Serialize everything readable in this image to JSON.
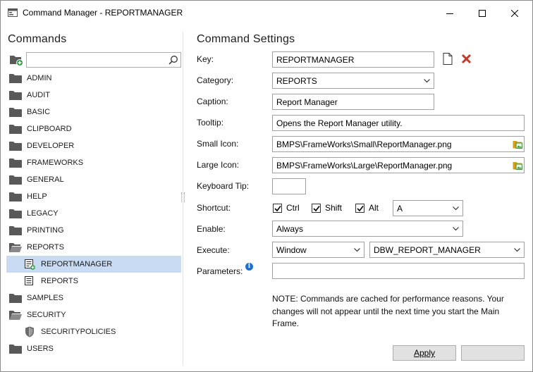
{
  "window": {
    "title": "Command Manager - REPORTMANAGER"
  },
  "left": {
    "title": "Commands",
    "search": {
      "value": "",
      "placeholder": ""
    },
    "tree": [
      {
        "label": "ADMIN",
        "level": 0,
        "icon": "folder-icon"
      },
      {
        "label": "AUDIT",
        "level": 0,
        "icon": "folder-icon"
      },
      {
        "label": "BASIC",
        "level": 0,
        "icon": "folder-icon"
      },
      {
        "label": "CLIPBOARD",
        "level": 0,
        "icon": "folder-icon"
      },
      {
        "label": "DEVELOPER",
        "level": 0,
        "icon": "folder-icon"
      },
      {
        "label": "FRAMEWORKS",
        "level": 0,
        "icon": "folder-icon"
      },
      {
        "label": "GENERAL",
        "level": 0,
        "icon": "folder-icon"
      },
      {
        "label": "HELP",
        "level": 0,
        "icon": "folder-icon"
      },
      {
        "label": "LEGACY",
        "level": 0,
        "icon": "folder-icon"
      },
      {
        "label": "PRINTING",
        "level": 0,
        "icon": "folder-icon"
      },
      {
        "label": "REPORTS",
        "level": 0,
        "icon": "folder-open-icon"
      },
      {
        "label": "REPORTMANAGER",
        "level": 1,
        "icon": "command-add-icon",
        "selected": true
      },
      {
        "label": "REPORTS",
        "level": 1,
        "icon": "command-icon"
      },
      {
        "label": "SAMPLES",
        "level": 0,
        "icon": "folder-icon"
      },
      {
        "label": "SECURITY",
        "level": 0,
        "icon": "folder-open-icon"
      },
      {
        "label": "SECURITYPOLICIES",
        "level": 1,
        "icon": "shield-icon"
      },
      {
        "label": "USERS",
        "level": 0,
        "icon": "folder-icon"
      }
    ]
  },
  "settings": {
    "title": "Command Settings",
    "key": {
      "label": "Key:",
      "value": "REPORTMANAGER"
    },
    "category": {
      "label": "Category:",
      "value": "REPORTS"
    },
    "caption": {
      "label": "Caption:",
      "value": "Report Manager"
    },
    "tooltip": {
      "label": "Tooltip:",
      "value": "Opens the Report Manager utility."
    },
    "small_icon": {
      "label": "Small Icon:",
      "value": "BMPS\\FrameWorks\\Small\\ReportManager.png"
    },
    "large_icon": {
      "label": "Large Icon:",
      "value": "BMPS\\FrameWorks\\Large\\ReportManager.png"
    },
    "keyboard_tip": {
      "label": "Keyboard Tip:",
      "value": ""
    },
    "shortcut": {
      "label": "Shortcut:",
      "ctrl": {
        "label": "Ctrl",
        "checked": true
      },
      "shift": {
        "label": "Shift",
        "checked": true
      },
      "alt": {
        "label": "Alt",
        "checked": true
      },
      "key": "A"
    },
    "enable": {
      "label": "Enable:",
      "value": "Always"
    },
    "execute": {
      "label": "Execute:",
      "type": "Window",
      "target": "DBW_REPORT_MANAGER"
    },
    "parameters": {
      "label": "Parameters:",
      "value": ""
    },
    "note": "NOTE: Commands are cached for performance reasons. Your changes will not appear until the next time you start the Main Frame.",
    "apply_label": "Apply",
    "cancel_label": ""
  }
}
